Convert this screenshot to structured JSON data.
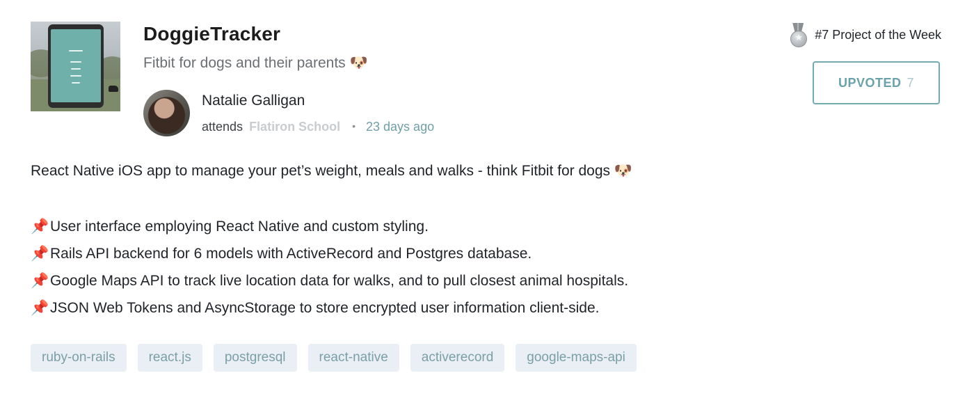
{
  "project": {
    "title": "DoggieTracker",
    "tagline": "Fitbit for dogs and their parents 🐶",
    "thumbnail_icon": "app-screenshot-thumbnail"
  },
  "author": {
    "name": "Natalie Galligan",
    "attends_label": "attends",
    "school": "Flatiron School",
    "separator": "•",
    "posted": "23 days ago"
  },
  "award": {
    "icon": "medal-icon",
    "label": "#7 Project of the Week"
  },
  "upvote": {
    "label": "UPVOTED",
    "count": "7",
    "accent": "#73aab0"
  },
  "description": {
    "intro": "React Native iOS app to manage your pet’s weight, meals and walks - think Fitbit for dogs 🐶",
    "bullet_icon": "📌",
    "bullets": [
      "User interface employing React Native and custom styling.",
      "Rails API backend for 6 models with ActiveRecord and Postgres database.",
      "Google Maps API to track live location data for walks, and to pull closest animal hospitals.",
      "JSON Web Tokens and AsyncStorage to store encrypted user information client-side."
    ]
  },
  "tags": [
    "ruby-on-rails",
    "react.js",
    "postgresql",
    "react-native",
    "activerecord",
    "google-maps-api"
  ],
  "colors": {
    "tag_bg": "#e9eff4",
    "tag_text": "#7a9fa6",
    "muted": "#6b6f73"
  }
}
